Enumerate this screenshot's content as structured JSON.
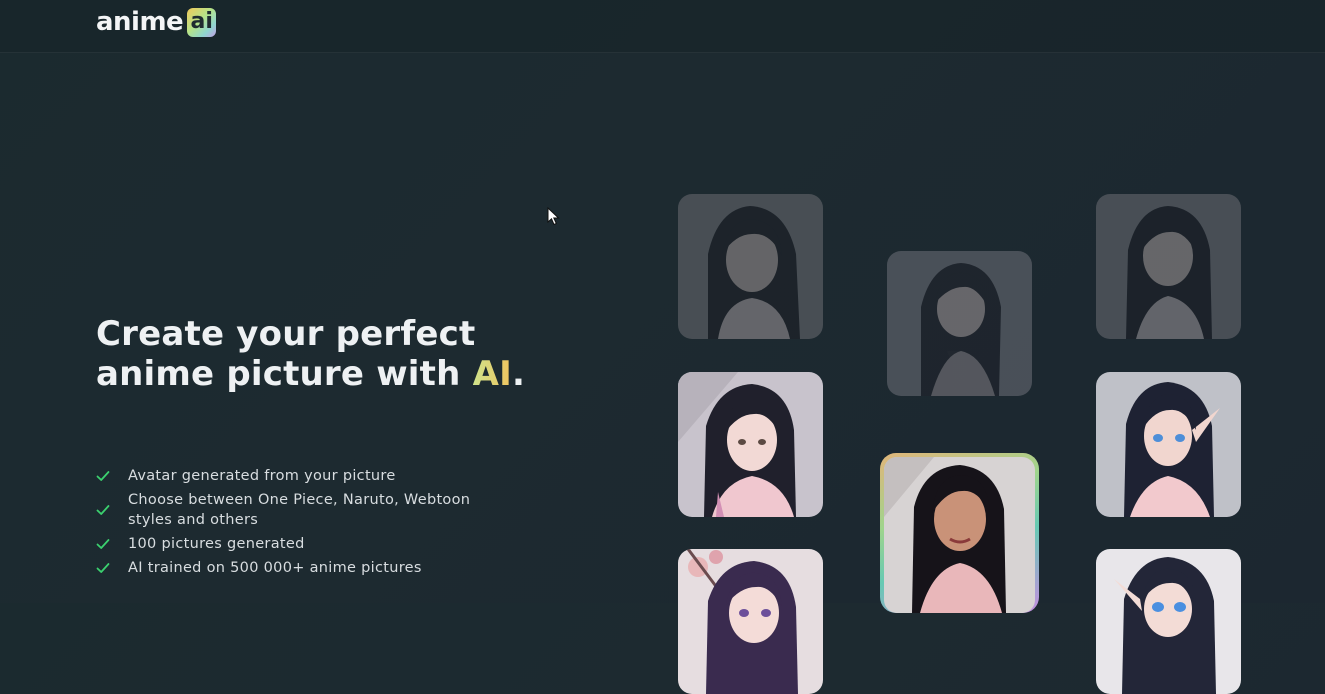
{
  "header": {
    "logo_word": "anime",
    "logo_badge": "ai"
  },
  "hero": {
    "headline_part1": "Create your perfect anime picture with ",
    "headline_highlight": "AI",
    "headline_end": "."
  },
  "features": [
    "Avatar generated from your picture",
    "Choose between One Piece, Naruto, Webtoon styles and others",
    "100 pictures generated",
    "AI trained on 500 000+ anime pictures"
  ],
  "icons": {
    "feature_check": "check-icon",
    "cursor": "mouse-cursor-icon"
  },
  "colors": {
    "background": "#1c2a30",
    "check_green": "#3bd16f",
    "ai_gradient_start": "#cfe38b",
    "ai_gradient_end": "#f0c35e",
    "featured_border_start": "#e2b57a",
    "featured_border_end": "#c48ee0"
  }
}
